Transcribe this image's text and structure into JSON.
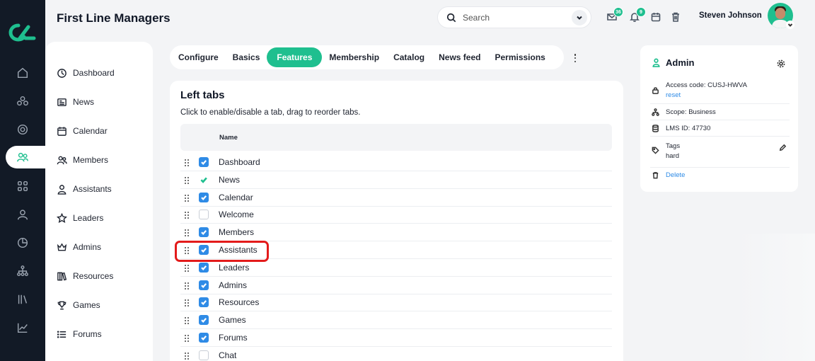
{
  "header": {
    "title": "First Line Managers",
    "search_placeholder": "Search",
    "messages_count": "36",
    "notifications_count": "9",
    "user_name": "Steven Johnson"
  },
  "sidebar": {
    "items": [
      {
        "label": "Dashboard",
        "icon": "dashboard-icon"
      },
      {
        "label": "News",
        "icon": "news-icon"
      },
      {
        "label": "Calendar",
        "icon": "calendar-icon"
      },
      {
        "label": "Members",
        "icon": "members-icon"
      },
      {
        "label": "Assistants",
        "icon": "assistant-icon"
      },
      {
        "label": "Leaders",
        "icon": "star-icon"
      },
      {
        "label": "Admins",
        "icon": "crown-icon"
      },
      {
        "label": "Resources",
        "icon": "books-icon"
      },
      {
        "label": "Games",
        "icon": "trophy-icon"
      },
      {
        "label": "Forums",
        "icon": "list-icon"
      }
    ]
  },
  "tabs": [
    "Configure",
    "Basics",
    "Features",
    "Membership",
    "Catalog",
    "News feed",
    "Permissions"
  ],
  "active_tab": "Features",
  "left_tabs": {
    "heading": "Left tabs",
    "description": "Click to enable/disable a tab, drag to reorder tabs.",
    "column_name": "Name",
    "rows": [
      {
        "label": "Dashboard",
        "state": "checked"
      },
      {
        "label": "News",
        "state": "locked"
      },
      {
        "label": "Calendar",
        "state": "checked"
      },
      {
        "label": "Welcome",
        "state": "unchecked"
      },
      {
        "label": "Members",
        "state": "checked"
      },
      {
        "label": "Assistants",
        "state": "checked"
      },
      {
        "label": "Leaders",
        "state": "checked"
      },
      {
        "label": "Admins",
        "state": "checked"
      },
      {
        "label": "Resources",
        "state": "checked"
      },
      {
        "label": "Games",
        "state": "checked"
      },
      {
        "label": "Forums",
        "state": "checked"
      },
      {
        "label": "Chat",
        "state": "unchecked"
      }
    ]
  },
  "info_panel": {
    "title": "Admin",
    "access_code": "Access code: CUSJ-HWVA",
    "reset_label": "reset",
    "scope": "Scope: Business",
    "lms_id": "LMS ID: 47730",
    "tags_label": "Tags",
    "tags_value": "hard",
    "delete_label": "Delete"
  },
  "colors": {
    "accent": "#1fbf8f",
    "rail": "#121a26",
    "checkbox": "#2f8be6",
    "highlight": "#e31b1b"
  }
}
